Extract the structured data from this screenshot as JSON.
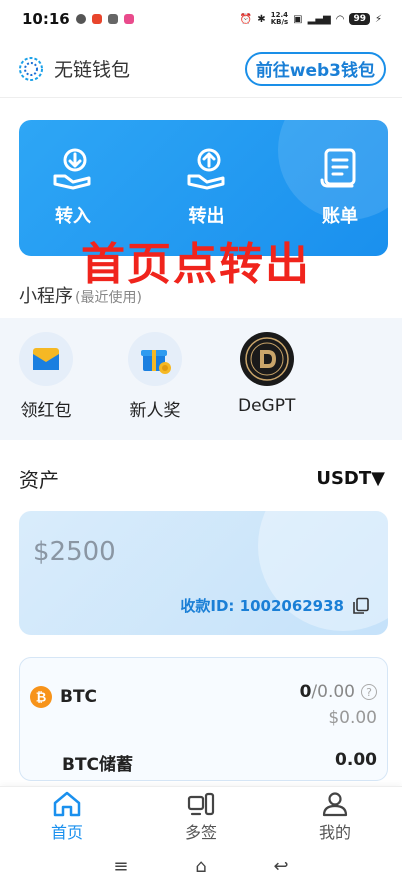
{
  "status_bar": {
    "time": "10:16",
    "speed_top": "12.4",
    "speed_bottom": "KB/s",
    "battery": "99"
  },
  "header": {
    "app_name": "无链钱包",
    "web3_button": "前往web3钱包"
  },
  "actions": [
    {
      "label": "转入",
      "icon": "transfer-in-icon"
    },
    {
      "label": "转出",
      "icon": "transfer-out-icon"
    },
    {
      "label": "账单",
      "icon": "bill-icon"
    }
  ],
  "overlay": {
    "text": "首页点转出"
  },
  "mini_programs": {
    "title": "小程序",
    "subtitle": "(最近使用)",
    "items": [
      {
        "label": "领红包",
        "icon": "red-packet-icon"
      },
      {
        "label": "新人奖",
        "icon": "gift-icon"
      },
      {
        "label": "DeGPT",
        "icon": "degpt-logo-icon"
      }
    ]
  },
  "assets": {
    "title": "资产",
    "currency": "USDT▼",
    "balance": "$2500",
    "receive_id_label": "收款ID: 1002062938"
  },
  "coin": {
    "symbol": "BTC",
    "held": "0",
    "total": "/0.00",
    "value": "$0.00",
    "savings_label": "BTC储蓄",
    "savings_value": "0.00"
  },
  "nav": [
    {
      "label": "首页",
      "active": true
    },
    {
      "label": "多签",
      "active": false
    },
    {
      "label": "我的",
      "active": false
    }
  ],
  "gestures": {
    "menu": "≡",
    "home": "⌂",
    "back": "↩"
  },
  "colors": {
    "primary": "#1a90ee",
    "overlay_red": "#f0241c",
    "btc_orange": "#f7931a"
  }
}
